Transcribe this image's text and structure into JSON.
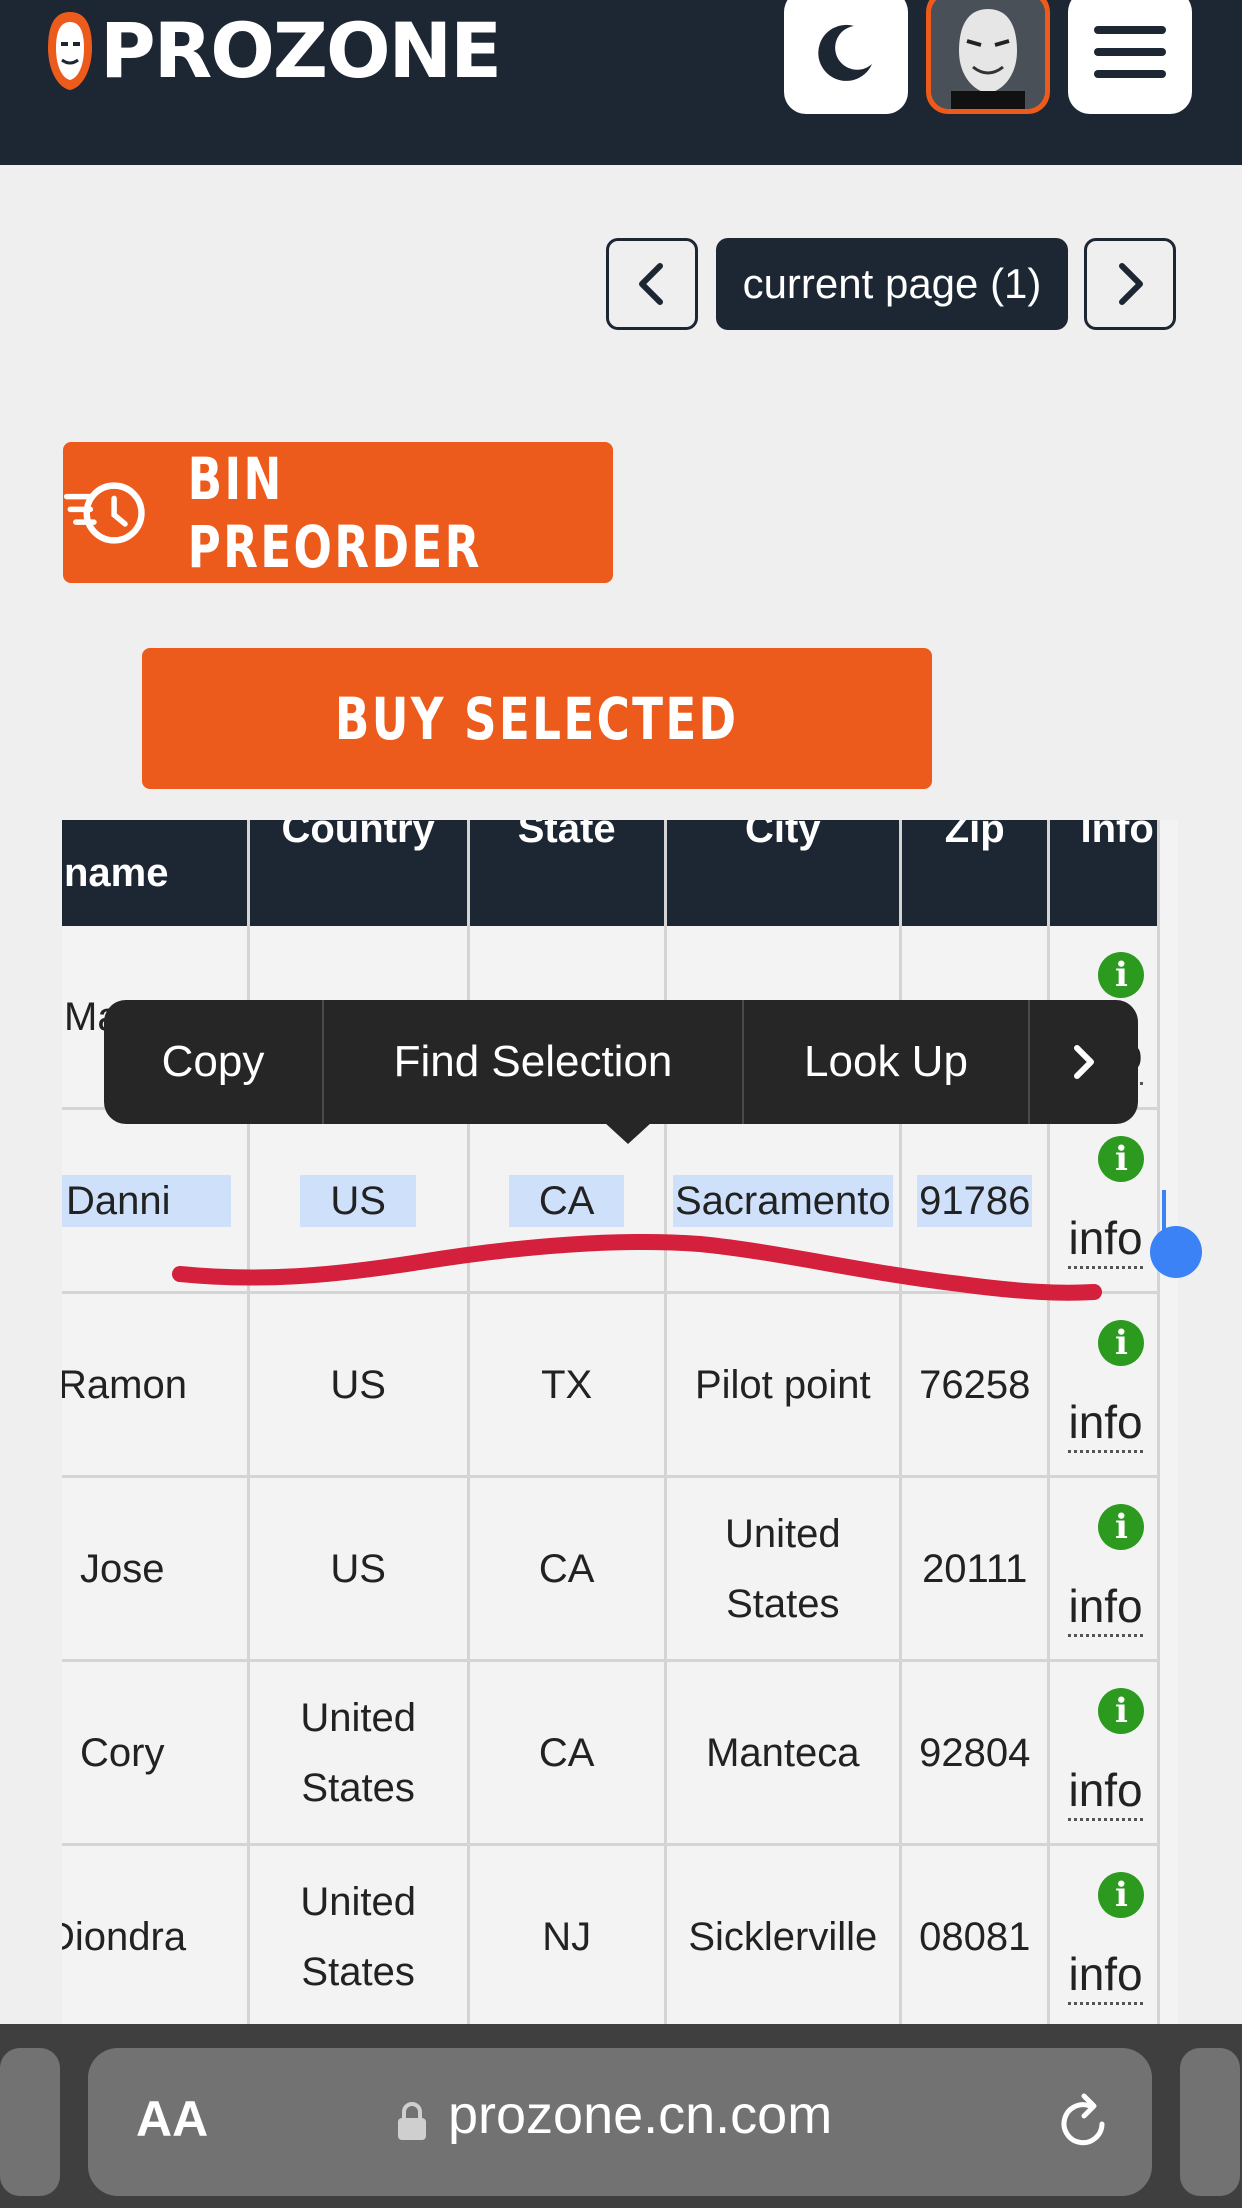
{
  "header": {
    "logo_text": "PROZONE",
    "theme_toggle_icon": "moon-icon",
    "menu_icon": "hamburger-icon"
  },
  "pager": {
    "prev_icon": "chevron-left-icon",
    "current_label": "current page (1)",
    "next_icon": "chevron-right-icon"
  },
  "actions": {
    "bin_preorder_label": "BIN PREORDER",
    "buy_selected_label": "BUY SELECTED"
  },
  "table": {
    "columns": [
      "name",
      "Country",
      "State",
      "City",
      "Zip",
      "Info"
    ],
    "rows": [
      {
        "name": "Ma",
        "country": "",
        "state": "",
        "city": "",
        "zip": "",
        "info": "info"
      },
      {
        "name": "Danni",
        "country": "US",
        "state": "CA",
        "city": "Sacramento",
        "zip": "91786",
        "info": "info"
      },
      {
        "name": "Ramon",
        "country": "US",
        "state": "TX",
        "city": "Pilot point",
        "zip": "76258",
        "info": "info"
      },
      {
        "name": "Jose",
        "country": "US",
        "state": "CA",
        "city": "United States",
        "zip": "20111",
        "info": "info"
      },
      {
        "name": "Cory",
        "country": "United States",
        "state": "CA",
        "city": "Manteca",
        "zip": "92804",
        "info": "info"
      },
      {
        "name": "Diondra",
        "country": "United States",
        "state": "NJ",
        "city": "Sicklerville",
        "zip": "08081",
        "info": "info"
      }
    ]
  },
  "context_menu": {
    "items": [
      "Copy",
      "Find Selection",
      "Look Up"
    ],
    "more_icon": "chevron-right-icon"
  },
  "browser": {
    "text_size_label": "AA",
    "url": "prozone.cn.com",
    "lock_icon": "lock-icon",
    "reload_icon": "reload-icon"
  },
  "colors": {
    "accent_orange": "#ed5b1c",
    "navy": "#1d2633",
    "info_green": "#2b9a1f",
    "selection_blue": "#cfe0fb",
    "annotation_red": "#d4203c"
  }
}
